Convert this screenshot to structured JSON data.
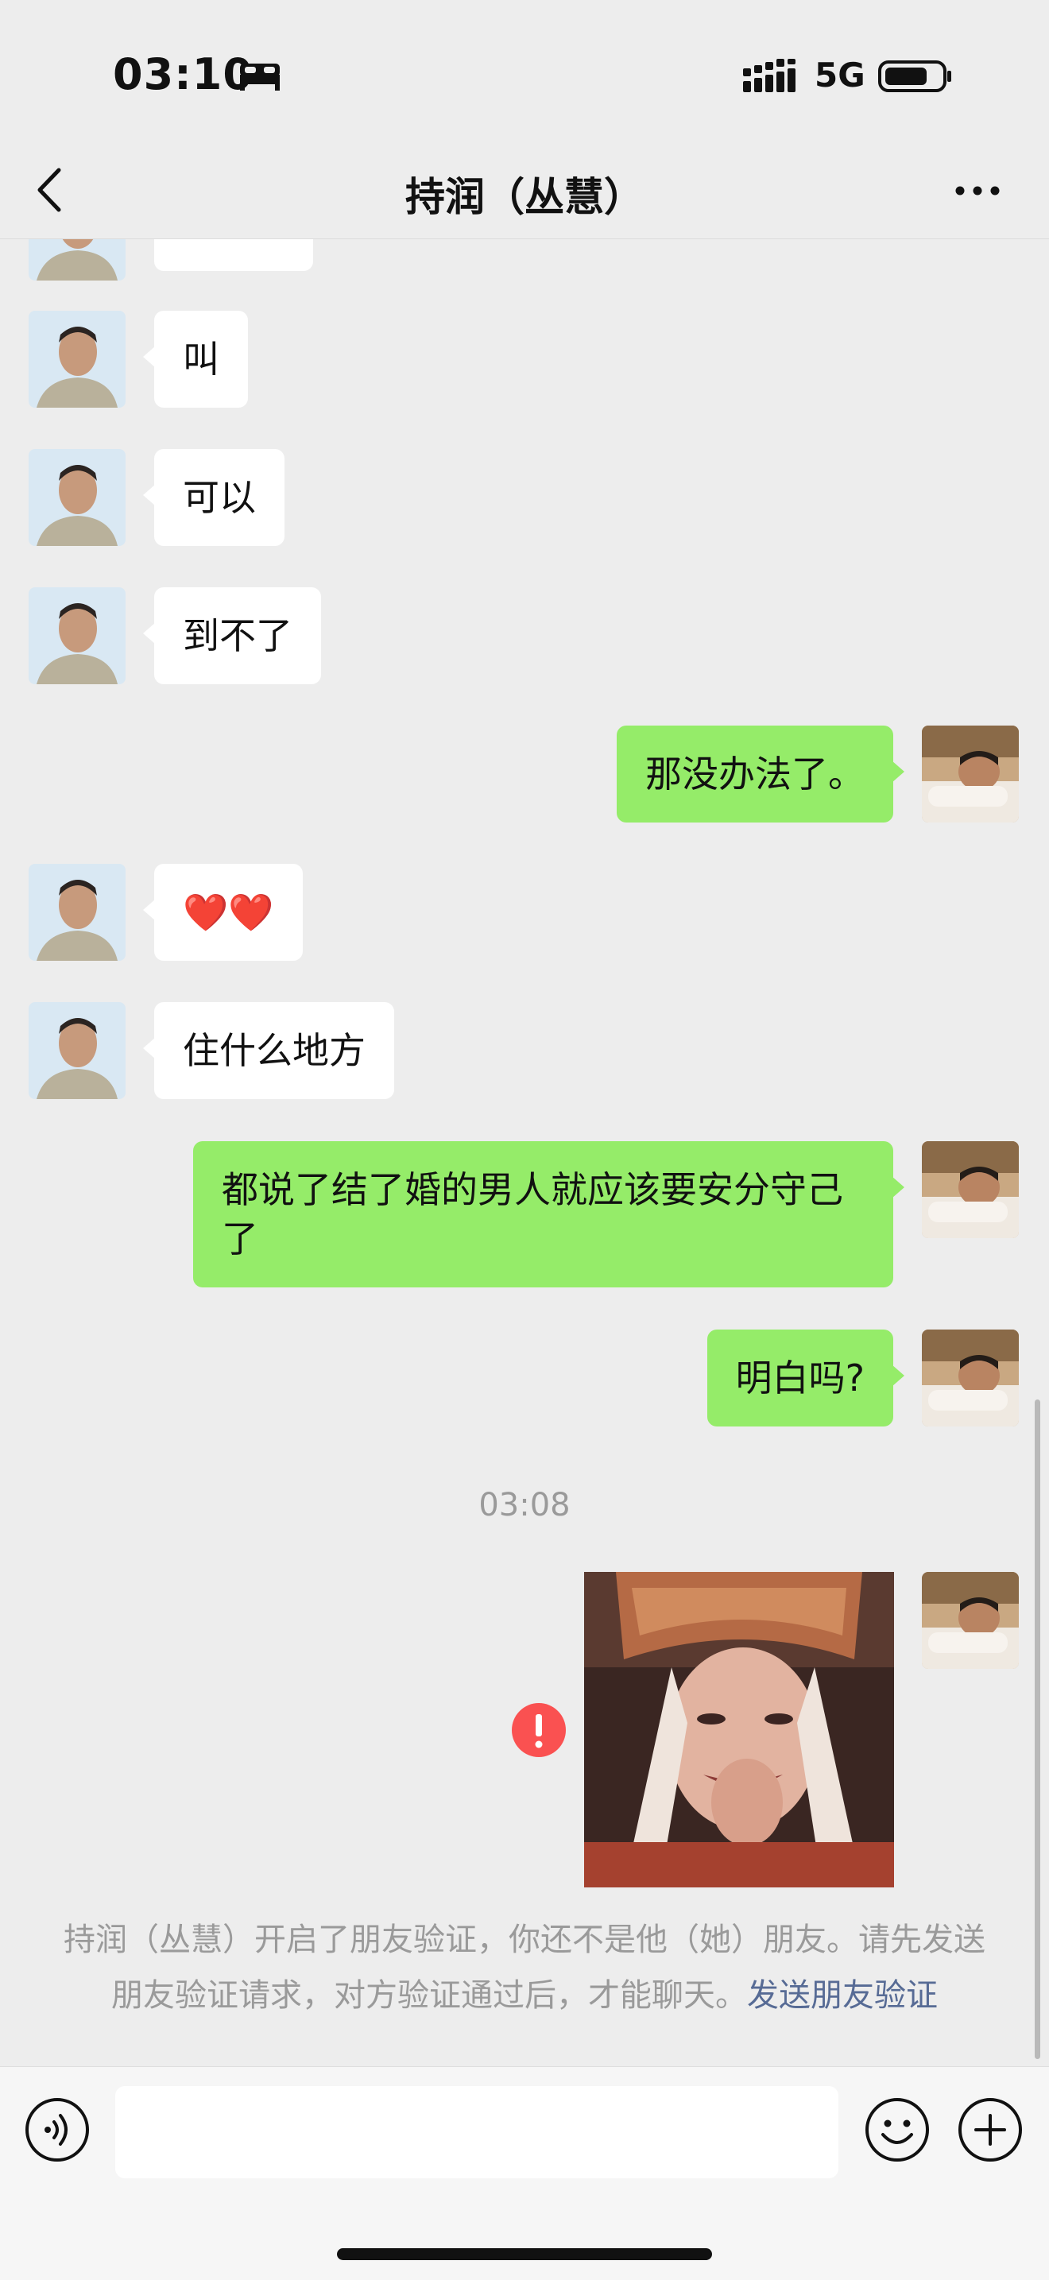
{
  "status_bar": {
    "time": "03:10",
    "network": "5G"
  },
  "nav": {
    "title": "持润（丛慧）"
  },
  "messages": [
    {
      "side": "in",
      "text": "叫"
    },
    {
      "side": "in",
      "text": "可以"
    },
    {
      "side": "in",
      "text": "到不了"
    },
    {
      "side": "out",
      "text": "那没办法了。"
    },
    {
      "side": "in",
      "text": "❤️❤️"
    },
    {
      "side": "in",
      "text": "住什么地方"
    },
    {
      "side": "out",
      "text": "都说了结了婚的男人就应该要安分守己了"
    },
    {
      "side": "out",
      "text": "明白吗?"
    }
  ],
  "timestamp": "03:08",
  "notice": {
    "text": "持润（丛慧）开启了朋友验证，你还不是他（她）朋友。请先发送朋友验证请求，对方验证通过后，才能聊天。",
    "link": "发送朋友验证"
  },
  "colors": {
    "outgoing_bubble": "#95ec69",
    "incoming_bubble": "#ffffff",
    "background": "#ededed",
    "link": "#576b95",
    "error": "#fa5151"
  }
}
